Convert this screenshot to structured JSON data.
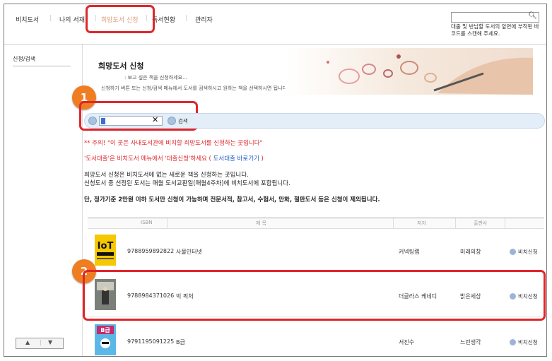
{
  "nav": {
    "items": [
      "비치도서",
      "나의 서재",
      "희망도서 신청",
      "독서현황",
      "관리자"
    ],
    "active_index": 2
  },
  "top_search": {
    "value": "",
    "hint": "대출 및 반납할 도서의 앞면에 부착된 바코드를 스캔해 주세요."
  },
  "sidebar": {
    "item": "신청/검색"
  },
  "pager": {
    "up": "▲",
    "down": "▼"
  },
  "banner": {
    "title": "희망도서 신청",
    "sub1": ": 보고 싶은 책을 신청하세요...",
    "sub2": "신청하기 버튼 또는 신청/검색 메뉴에서 도서를 검색하시고 원하는 책을 선택하시면 됩니다."
  },
  "search": {
    "value": "",
    "clear": "✕",
    "button": "검색"
  },
  "callouts": [
    "1",
    "2"
  ],
  "notices": {
    "line1": "** 주의!   \"이 곳은 사내도서관에 비치할 희망도서를 신청하는 곳입니다\"",
    "line2a": "'도서대출'은 비치도서 메뉴에서 '대출신청'하세요 (",
    "line2b": " 도서대출 바로가기 ",
    "line2c": ")",
    "line3": "희망도서 신청은 비치도서에 없는 새로운 책을 신청하는 곳입니다.",
    "line4": "신청도서 중 선정된 도서는 매월 도서교환일(매월4주차)에 비치도서에 포함됩니다.",
    "line5": "단, 정가기준 2만원 이하 도서만 신청이 가능하며 전문서적, 참고서, 수험서, 만화, 절판도서 등은 신청이 제외됩니다."
  },
  "table": {
    "headers": [
      "ISBN",
      "제 목",
      "저자",
      "출판사"
    ],
    "rows": [
      {
        "cover": "IoT 사물인터넷",
        "isbn": "9788959892822",
        "title": "사물인터넷",
        "author": "커넥팅랩",
        "publisher": "미래의창",
        "action": "비치신청"
      },
      {
        "cover": "빅 픽처",
        "isbn": "9788984371026",
        "title": "빅 픽처",
        "author": "더글라스 케네디",
        "publisher": "밝은세상",
        "action": "비치신청"
      },
      {
        "cover": "B급",
        "isbn": "9791195091225",
        "title": "B급",
        "author": "서진수",
        "publisher": "느린생각",
        "action": "비치신청"
      }
    ]
  },
  "colors": {
    "highlight": "#e0262b",
    "callout": "#ef7d22",
    "notice_red": "#e0262b",
    "link_blue": "#1e5bc6"
  }
}
